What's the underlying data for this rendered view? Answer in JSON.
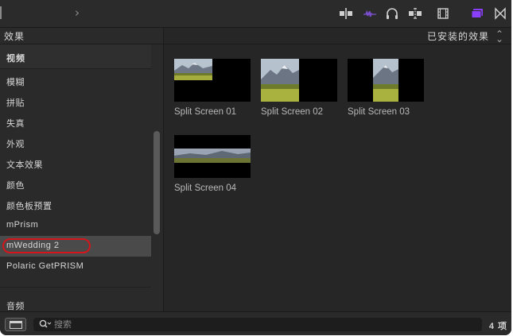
{
  "toolbar": {
    "back_glyph": "›",
    "icons": [
      "split-clip-icon",
      "audio-waveform-icon",
      "headphones-icon",
      "snapping-icon",
      "filmstrip-icon",
      "browser-effects-icon",
      "transitions-icon"
    ],
    "accent_color": "#8a3ffc"
  },
  "sidebar": {
    "title": "效果",
    "video_header": "视频",
    "items": [
      {
        "label": "模糊"
      },
      {
        "label": "拼贴"
      },
      {
        "label": "失真"
      },
      {
        "label": "外观"
      },
      {
        "label": "文本效果"
      },
      {
        "label": "颜色"
      },
      {
        "label": "颜色板预置"
      },
      {
        "label": "mPrism"
      },
      {
        "label": "mWedding 2",
        "selected": true
      },
      {
        "label": "Polaric GetPRISM"
      }
    ],
    "audio_header": "音频",
    "highlight_color": "#d4151b"
  },
  "main": {
    "filter_label": "已安装的效果",
    "sort_glyph": "⌃⌄",
    "tiles": [
      {
        "label": "Split Screen 01"
      },
      {
        "label": "Split Screen 02"
      },
      {
        "label": "Split Screen 03"
      },
      {
        "label": "Split Screen 04"
      }
    ]
  },
  "bottombar": {
    "search_placeholder": "搜索",
    "item_count": "4 项"
  }
}
